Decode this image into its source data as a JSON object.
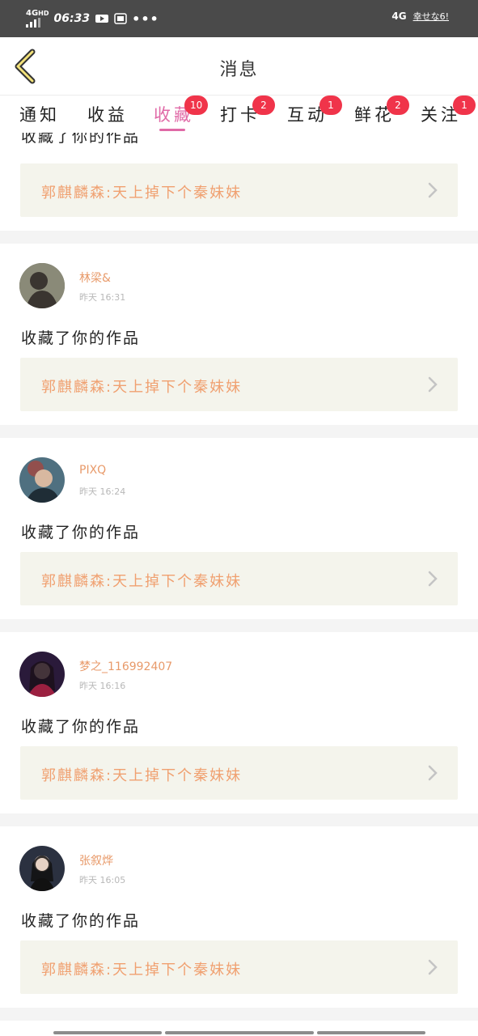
{
  "status_bar": {
    "network": "4G",
    "network_sub": "HD",
    "time": "06:33",
    "net_right": "4G",
    "speed": "幸せな6!"
  },
  "header": {
    "title": "消息"
  },
  "tabs": [
    {
      "label": "通知",
      "badge": ""
    },
    {
      "label": "收益",
      "badge": ""
    },
    {
      "label": "收藏",
      "badge": "10"
    },
    {
      "label": "打卡",
      "badge": "2"
    },
    {
      "label": "互动",
      "badge": "1"
    },
    {
      "label": "鲜花",
      "badge": "2"
    },
    {
      "label": "关注",
      "badge": "1"
    }
  ],
  "first_partial": {
    "action": "收藏了你的作品",
    "work": "郭麒麟森:天上掉下个秦妹妹"
  },
  "items": [
    {
      "name": "林梁&",
      "time": "昨天 16:31",
      "action": "收藏了你的作品",
      "work": "郭麒麟森:天上掉下个秦妹妹",
      "avatar_color": "#6b6b5a"
    },
    {
      "name": "PIXQ",
      "time": "昨天 16:24",
      "action": "收藏了你的作品",
      "work": "郭麒麟森:天上掉下个秦妹妹",
      "avatar_color": "#3d5a6b"
    },
    {
      "name": "梦之_116992407",
      "time": "昨天 16:16",
      "action": "收藏了你的作品",
      "work": "郭麒麟森:天上掉下个秦妹妹",
      "avatar_color": "#5a2a4a"
    },
    {
      "name": "张叙烨",
      "time": "昨天 16:05",
      "action": "收藏了你的作品",
      "work": "郭麒麟森:天上掉下个秦妹妹",
      "avatar_color": "#2b3140"
    }
  ],
  "icons": {
    "back": "chevron-left-icon",
    "card_arrow": "chevron-right-icon",
    "video": "video-icon",
    "more": "more-dots-icon"
  }
}
